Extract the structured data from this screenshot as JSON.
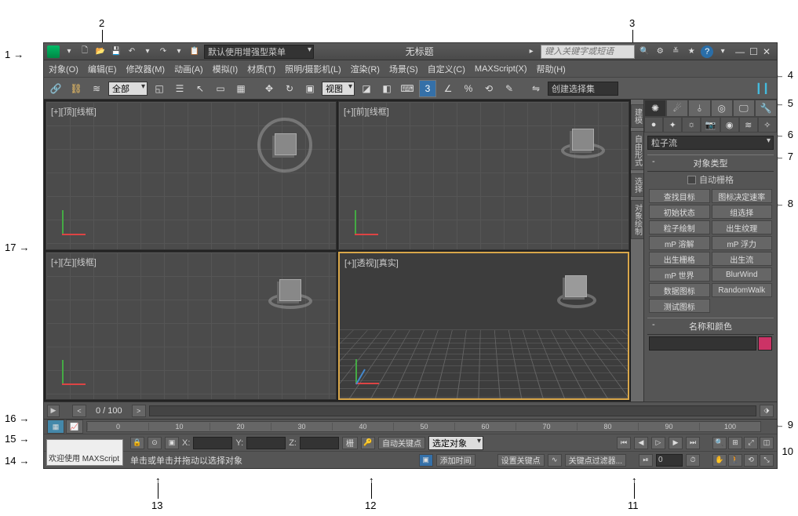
{
  "titlebar": {
    "workspace_dd": "默认使用增强型菜单",
    "title": "无标题",
    "search_placeholder": "键入关键字或短语",
    "help": "?"
  },
  "menus": [
    "对象(O)",
    "编辑(E)",
    "修改器(M)",
    "动画(A)",
    "模拟(I)",
    "材质(T)",
    "照明/摄影机(L)",
    "渲染(R)",
    "场景(S)",
    "自定义(C)",
    "MAXScript(X)",
    "帮助(H)"
  ],
  "maintoolbar": {
    "filter_dd": "全部",
    "refcoord_dd": "视图",
    "snap_label": "3",
    "angle_label": "%",
    "named_sel": "创建选择集"
  },
  "viewports": {
    "topleft": "[+][顶][线框]",
    "topright": "[+][前][线框]",
    "botleft": "[+][左][线框]",
    "botright": "[+][透视][真实]"
  },
  "vtabs": [
    "建模",
    "自由形式",
    "选择",
    "对象绘制"
  ],
  "command_panel": {
    "category_dd": "粒子流",
    "rollout1": "对象类型",
    "autogrid": "自动栅格",
    "buttons": [
      [
        "查找目标",
        "图标决定速率"
      ],
      [
        "初始状态",
        "组选择"
      ],
      [
        "粒子绘制",
        "出生纹理"
      ],
      [
        "mP 溶解",
        "mP 浮力"
      ],
      [
        "出生栅格",
        "出生流"
      ],
      [
        "mP 世界",
        "BlurWind"
      ],
      [
        "数据图标",
        "RandomWalk"
      ],
      [
        "测试图标",
        ""
      ]
    ],
    "rollout2": "名称和颜色"
  },
  "trackbar": {
    "frame": "0 / 100"
  },
  "timeline_ticks": [
    "0",
    "10",
    "20",
    "30",
    "40",
    "50",
    "60",
    "70",
    "80",
    "90",
    "100"
  ],
  "status": {
    "x": "X:",
    "y": "Y:",
    "z": "Z:",
    "grid": "栅",
    "autokey": "自动关键点",
    "setkey": "设置关键点",
    "selobj": "选定对象",
    "keyfilters": "关键点过滤器...",
    "addtime": "添加时间",
    "spinner": "0",
    "prompt": "单击或单击并拖动以选择对象"
  },
  "welcome": "欢迎使用 MAXScript",
  "annotations": {
    "1": "1",
    "2": "2",
    "3": "3",
    "4": "4",
    "5": "5",
    "6": "6",
    "7": "7",
    "8": "8",
    "9": "9",
    "10": "10",
    "11": "11",
    "12": "12",
    "13": "13",
    "14": "14",
    "15": "15",
    "16": "16",
    "17": "17"
  }
}
